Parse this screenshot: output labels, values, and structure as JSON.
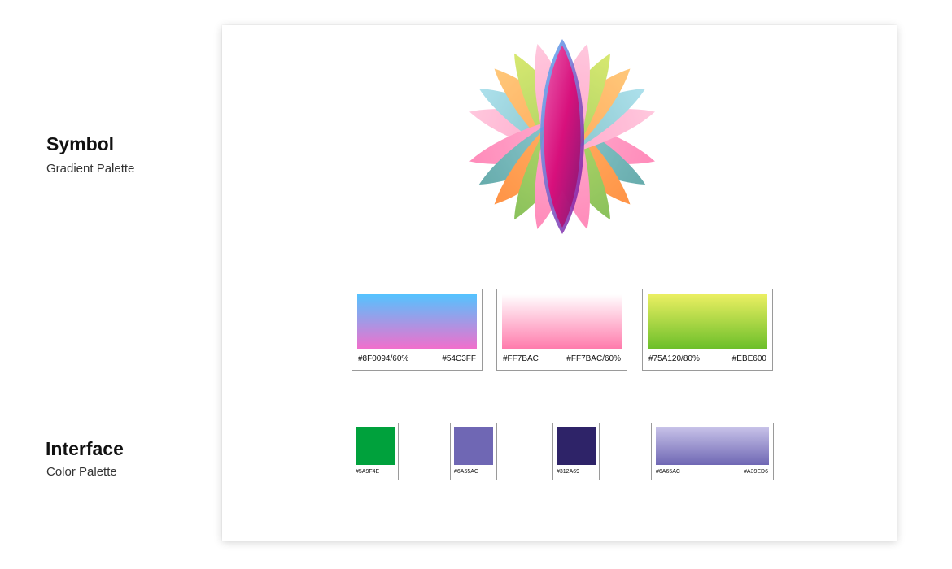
{
  "sections": {
    "symbol": {
      "title": "Symbol",
      "subtitle": "Gradient Palette"
    },
    "interface": {
      "title": "Interface",
      "subtitle": "Color Palette"
    }
  },
  "gradient_palette": [
    {
      "left_label": "#8F0094/60%",
      "right_label": "#54C3FF",
      "top_color": "#54C3FF",
      "bottom_color": "#F16FCC"
    },
    {
      "left_label": "#FF7BAC",
      "right_label": "#FF7BAC/60%",
      "top_color": "#FFFFFF",
      "bottom_color": "#FF7BAC"
    },
    {
      "left_label": "#75A120/80%",
      "right_label": "#EBE600",
      "top_color": "#EBEF62",
      "bottom_color": "#6CBF2A"
    }
  ],
  "interface_palette": {
    "solids": [
      {
        "label": "#5A9F4E",
        "color": "#00A13C"
      },
      {
        "label": "#6A65AC",
        "color": "#6F67B4"
      },
      {
        "label": "#312A69",
        "color": "#2E2368"
      }
    ],
    "gradient": {
      "left_label": "#6A65AC",
      "right_label": "#A39ED6",
      "top_color": "#C8C3E9",
      "bottom_color": "#6F67B4"
    }
  }
}
